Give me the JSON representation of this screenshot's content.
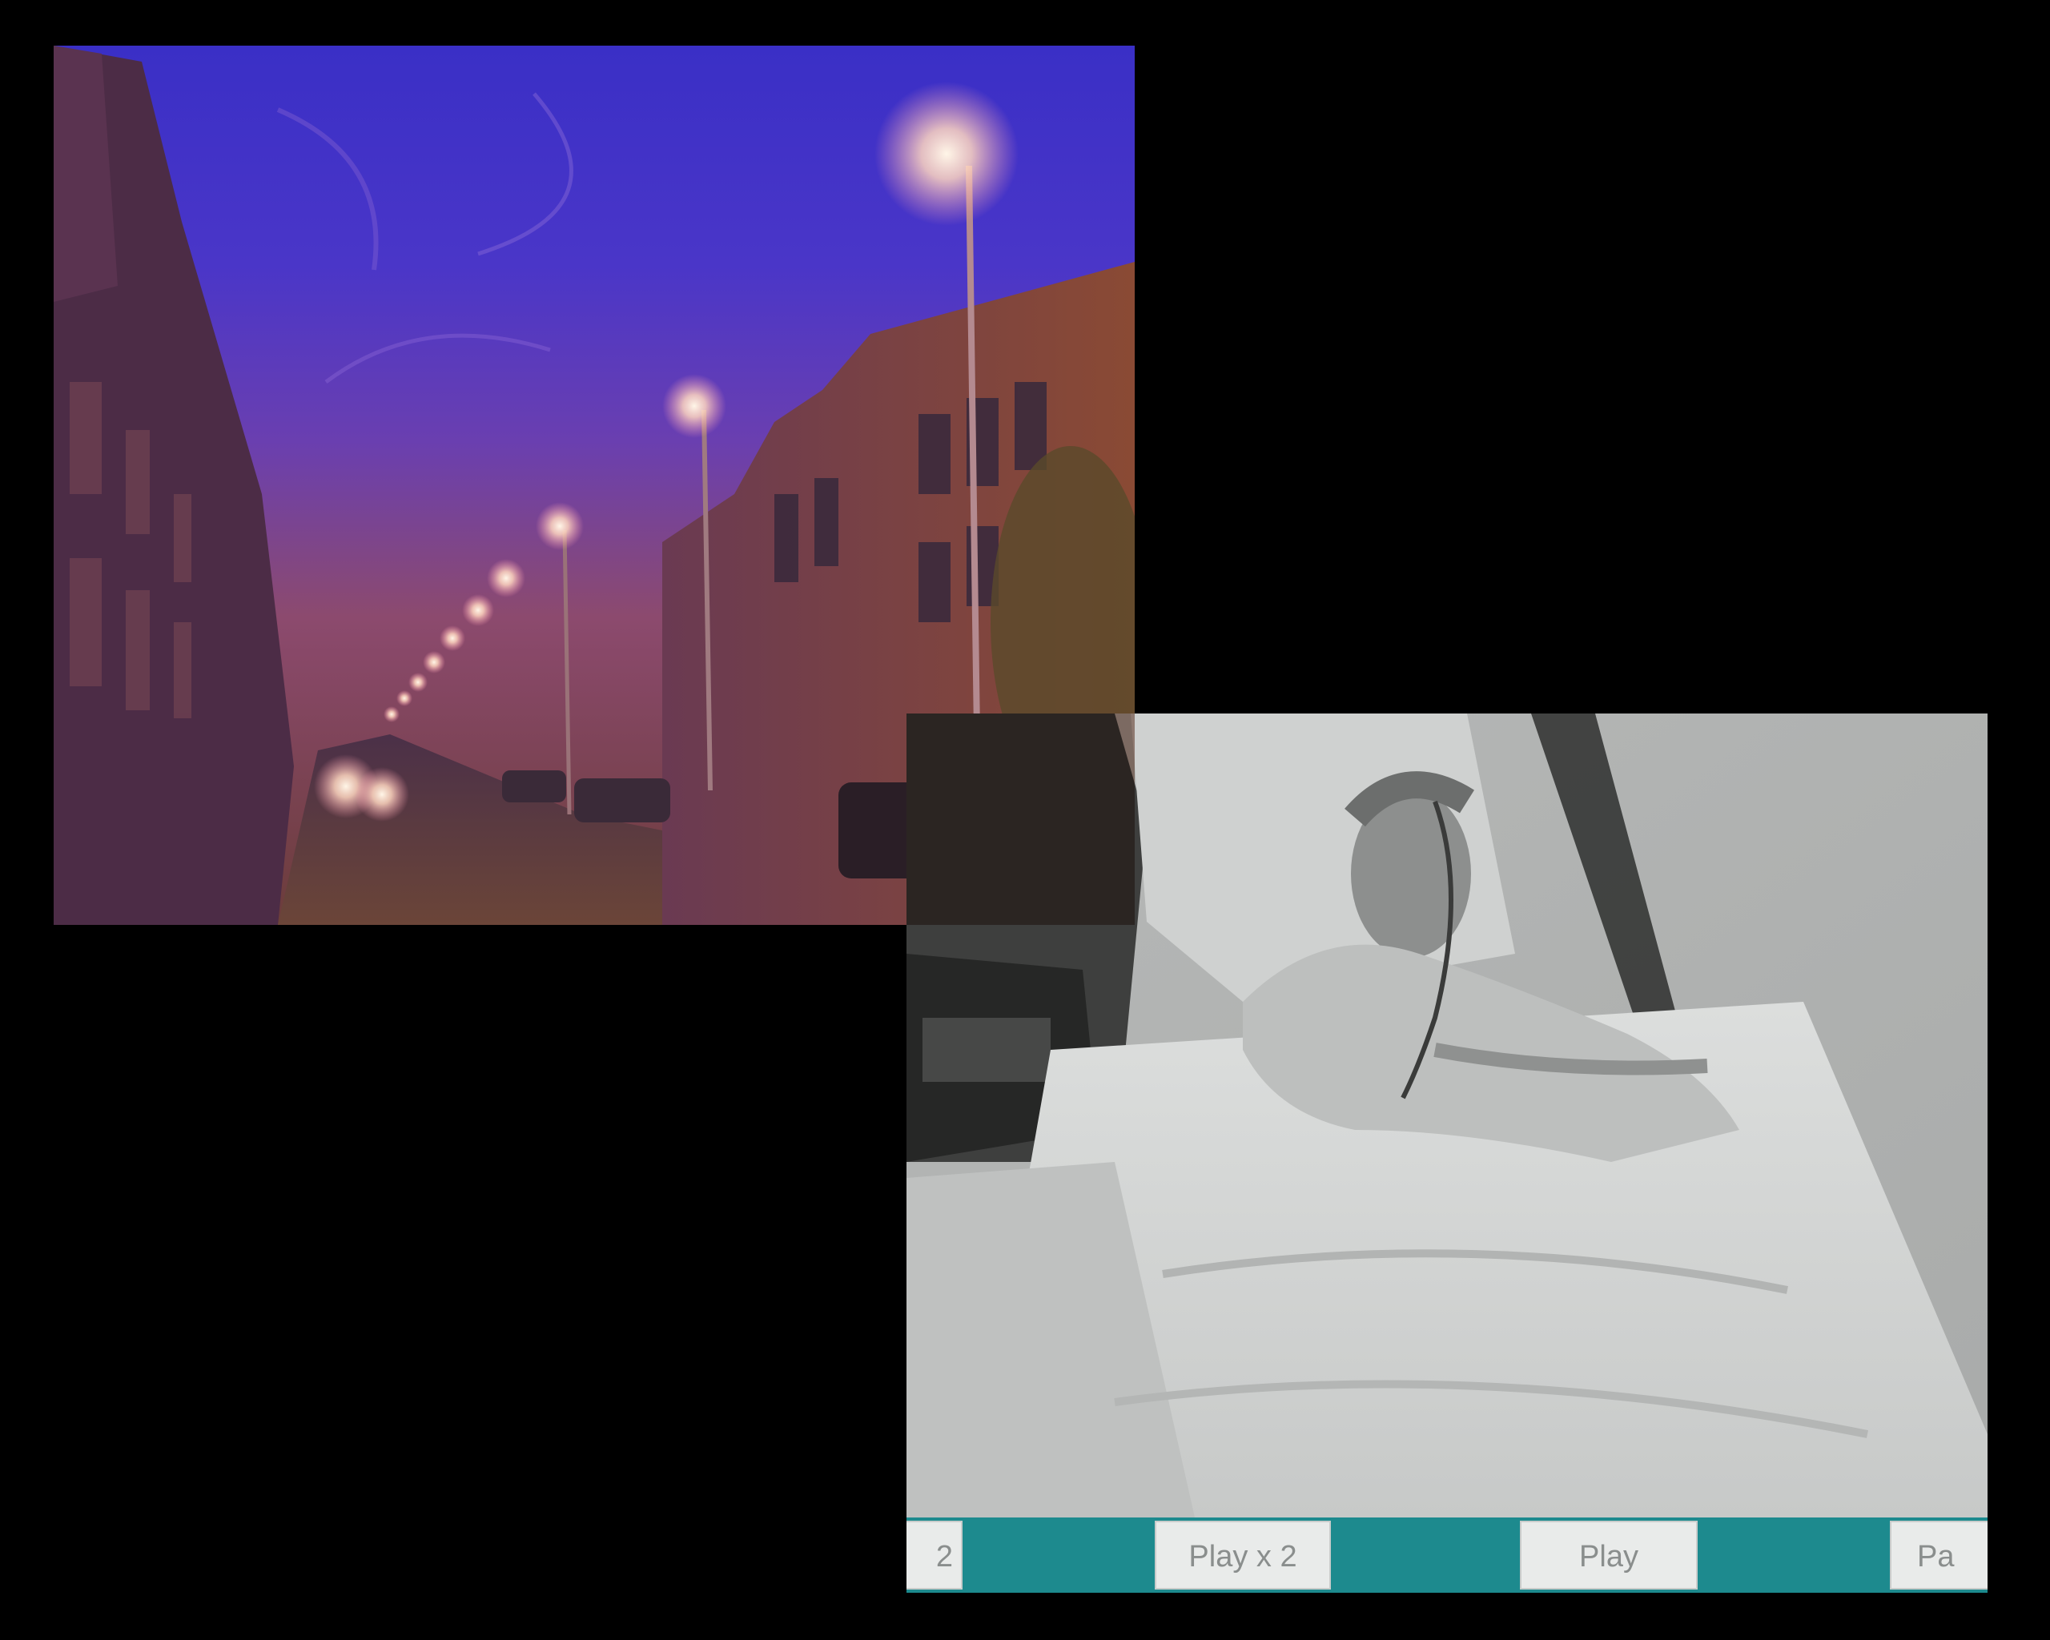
{
  "street_image": {
    "icon": "night-street-photo"
  },
  "bedroom_image": {
    "icon": "night-vision-bedroom-photo"
  },
  "playback_bar": {
    "color": "#1d8a8e",
    "buttons": [
      {
        "label": "2"
      },
      {
        "label": "Play x 2"
      },
      {
        "label": "Play"
      },
      {
        "label": "Pa"
      }
    ]
  }
}
